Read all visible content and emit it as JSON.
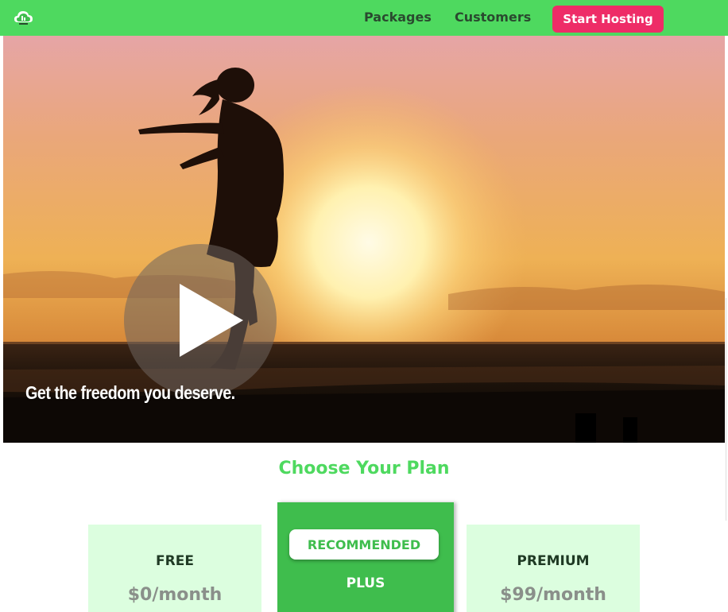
{
  "navbar": {
    "links": [
      "Packages",
      "Customers"
    ],
    "cta_label": "Start Hosting",
    "colors": {
      "background": "#4ed95f",
      "cta": "#ee2c67",
      "link_text": "#2a4a2f"
    }
  },
  "hero": {
    "tagline": "Get the freedom you deserve.",
    "play_icon": "play-icon"
  },
  "pricing": {
    "title": "Choose Your Plan",
    "plans": [
      {
        "name": "FREE",
        "price": "$0/month"
      },
      {
        "name": "PLUS",
        "badge": "RECOMMENDED",
        "price": ""
      },
      {
        "name": "PREMIUM",
        "price": "$99/month"
      }
    ],
    "colors": {
      "accent": "#4ed95f",
      "card": "#dcfedf",
      "recommended": "#3fbd4d"
    }
  }
}
